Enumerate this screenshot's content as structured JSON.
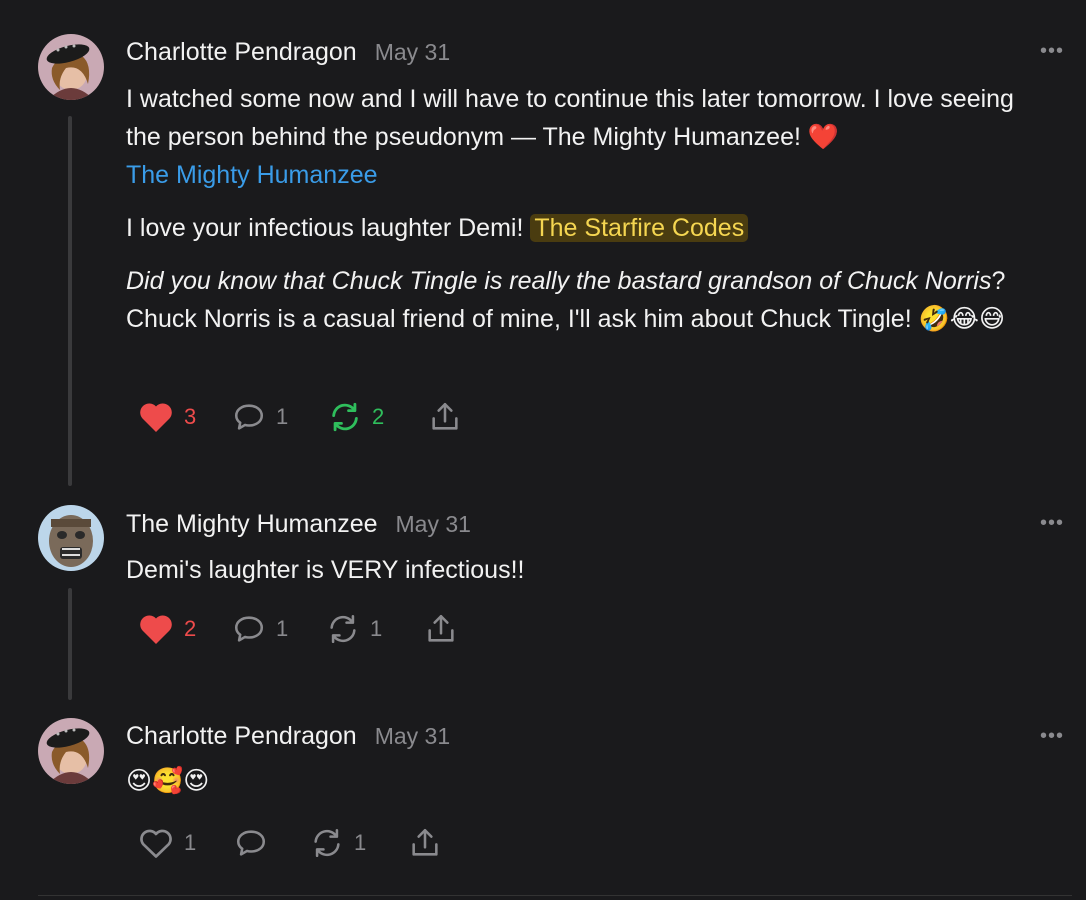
{
  "posts": [
    {
      "author": "Charlotte Pendragon",
      "date": "May 31",
      "text_line1": "I watched some now and I will have to continue this later tomorrow. I love seeing the person behind the pseudonym — The Mighty Humanzee! ❤️",
      "mention": "The Mighty Humanzee",
      "text_p2": "I love your infectious laughter Demi!",
      "highlight": "The Starfire Codes",
      "italic_part": "Did you know that Chuck Tingle is really the bastard grandson of Chuck Norris",
      "text_p3_rest": "? Chuck Norris is a casual friend of mine, I'll ask him about Chuck Tingle! 🤣😂😅",
      "likes": "3",
      "comments": "1",
      "restacks": "2",
      "liked": true,
      "restacked": true,
      "avatar_icon": "avatar-woman-hat"
    },
    {
      "author": "The Mighty Humanzee",
      "date": "May 31",
      "text": "Demi's laughter is VERY infectious!!",
      "likes": "2",
      "comments": "1",
      "restacks": "1",
      "liked": true,
      "restacked": false,
      "avatar_icon": "avatar-chimp-statue"
    },
    {
      "author": "Charlotte Pendragon",
      "date": "May 31",
      "text": "😍🥰😍",
      "likes": "1",
      "comments": "",
      "restacks": "1",
      "liked": false,
      "restacked": false,
      "avatar_icon": "avatar-woman-hat"
    }
  ],
  "more_label": "•••",
  "colors": {
    "background": "#1a1a1c",
    "link": "#3a9ce8",
    "highlight_bg": "#4a3c10",
    "highlight_text": "#f5d651",
    "like": "#ee4b4b",
    "restack_active": "#2fbe5c",
    "muted": "#8a8a8e"
  }
}
